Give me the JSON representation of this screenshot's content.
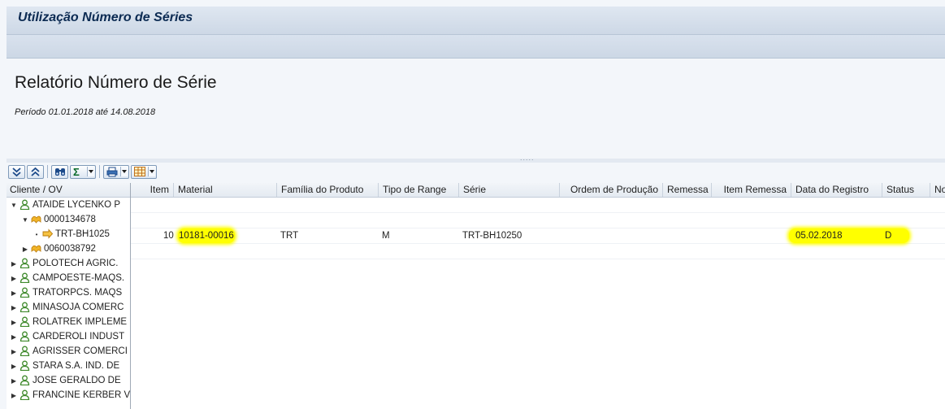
{
  "window": {
    "title": "Utilização Número de Séries"
  },
  "report": {
    "title": "Relatório Número de Série",
    "period": "Período 01.01.2018 até 14.08.2018"
  },
  "colors": {
    "highlight": "#ffff00",
    "title_text": "#0b2a52"
  },
  "toolbar_icons": [
    "expand-all-icon",
    "collapse-all-icon",
    "find-icon",
    "sum-icon",
    "print-icon",
    "layout-icon"
  ],
  "tree": {
    "header": "Cliente / OV",
    "nodes": [
      {
        "label": "ATAIDE LYCENKO P",
        "level": 0,
        "state": "expanded",
        "icon": "customer"
      },
      {
        "label": "0000134678",
        "level": 1,
        "state": "expanded",
        "icon": "order"
      },
      {
        "label": "TRT-BH1025",
        "level": 2,
        "state": "leaf",
        "icon": "serial"
      },
      {
        "label": "0060038792",
        "level": 1,
        "state": "collapsed",
        "icon": "order"
      },
      {
        "label": "POLOTECH AGRIC.",
        "level": 0,
        "state": "collapsed",
        "icon": "customer"
      },
      {
        "label": "CAMPOESTE-MAQS.",
        "level": 0,
        "state": "collapsed",
        "icon": "customer"
      },
      {
        "label": "TRATORPCS. MAQS",
        "level": 0,
        "state": "collapsed",
        "icon": "customer"
      },
      {
        "label": "MINASOJA COMERC",
        "level": 0,
        "state": "collapsed",
        "icon": "customer"
      },
      {
        "label": "ROLATREK IMPLEME",
        "level": 0,
        "state": "collapsed",
        "icon": "customer"
      },
      {
        "label": "CARDEROLI INDUST",
        "level": 0,
        "state": "collapsed",
        "icon": "customer"
      },
      {
        "label": "AGRISSER COMERCI",
        "level": 0,
        "state": "collapsed",
        "icon": "customer"
      },
      {
        "label": "STARA S.A. IND. DE",
        "level": 0,
        "state": "collapsed",
        "icon": "customer"
      },
      {
        "label": "JOSE GERALDO DE",
        "level": 0,
        "state": "collapsed",
        "icon": "customer"
      },
      {
        "label": "FRANCINE KERBER V",
        "level": 0,
        "state": "collapsed",
        "icon": "customer"
      }
    ]
  },
  "grid": {
    "columns": [
      "Item",
      "Material",
      "Família do Produto",
      "Tipo de Range",
      "Série",
      "Ordem de Produção",
      "Remessa",
      "Item Remessa",
      "Data do Registro",
      "Status",
      "Not"
    ],
    "rows": [
      {
        "item": "10",
        "material": "10181-00016",
        "familia": "TRT",
        "tipo": "M",
        "serie": "TRT-BH10250",
        "ordem": "",
        "remessa": "",
        "item_remessa": "",
        "data": "05.02.2018",
        "status": "D"
      }
    ]
  }
}
